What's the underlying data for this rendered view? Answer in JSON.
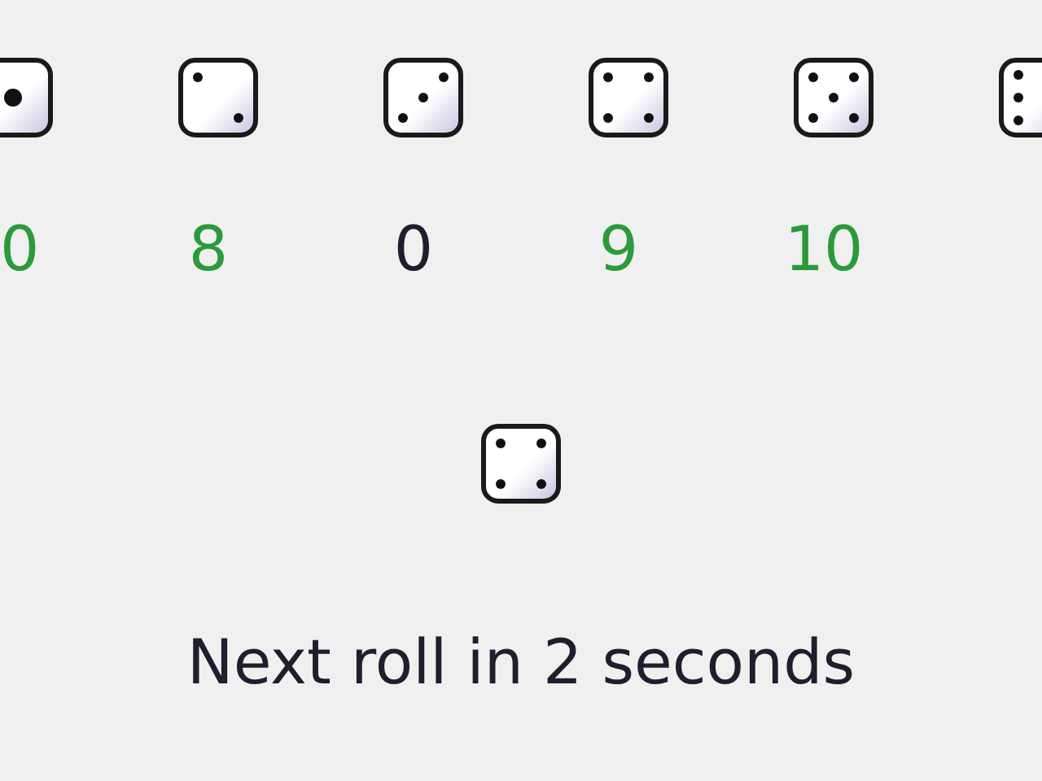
{
  "dice": [
    {
      "kind": "one",
      "count": "0",
      "color": "#2a9a3a"
    },
    {
      "kind": "two",
      "count": "8",
      "color": "#2a9a3a"
    },
    {
      "kind": "three",
      "count": "0",
      "color": "#1e1e2e"
    },
    {
      "kind": "four",
      "count": "9",
      "color": "#2a9a3a"
    },
    {
      "kind": "five",
      "count": "10",
      "color": "#2a9a3a"
    },
    {
      "kind": "six"
    }
  ],
  "current": {
    "kind": "four"
  },
  "status": "Next roll in 2 seconds"
}
